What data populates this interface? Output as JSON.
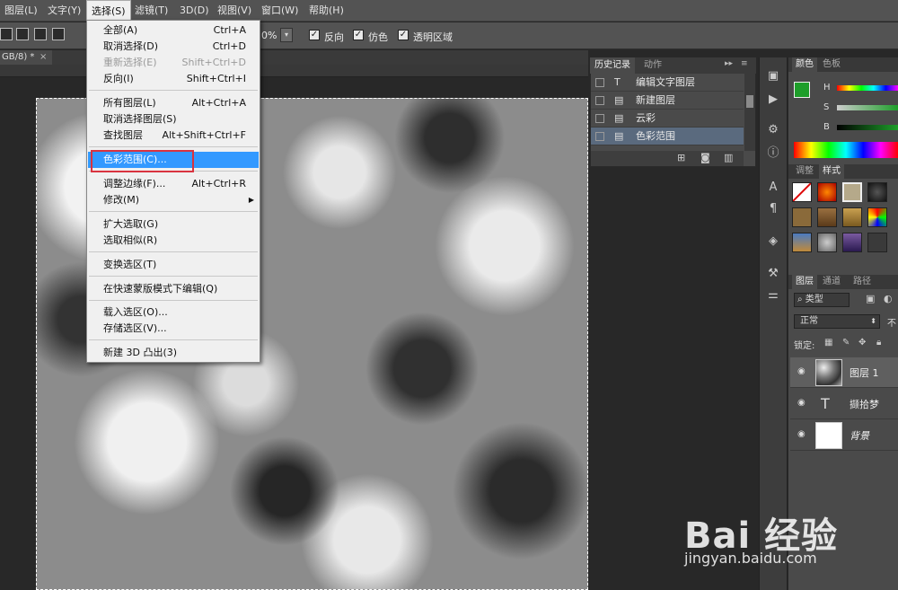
{
  "menubar": {
    "items": [
      "图层(L)",
      "文字(Y)",
      "选择(S)",
      "滤镜(T)",
      "3D(D)",
      "视图(V)",
      "窗口(W)",
      "帮助(H)"
    ]
  },
  "options": {
    "zoom": "0%",
    "invert_label": "反向",
    "dither_label": "仿色",
    "transparency_label": "透明区域"
  },
  "document": {
    "tab_title": "GB/8) *"
  },
  "select_menu": {
    "items": [
      {
        "label": "全部(A)",
        "shortcut": "Ctrl+A"
      },
      {
        "label": "取消选择(D)",
        "shortcut": "Ctrl+D"
      },
      {
        "label": "重新选择(E)",
        "shortcut": "Shift+Ctrl+D"
      },
      {
        "label": "反向(I)",
        "shortcut": "Shift+Ctrl+I"
      },
      {
        "label": "所有图层(L)",
        "shortcut": "Alt+Ctrl+A"
      },
      {
        "label": "取消选择图层(S)",
        "shortcut": ""
      },
      {
        "label": "查找图层",
        "shortcut": "Alt+Shift+Ctrl+F"
      },
      {
        "label": "色彩范围(C)...",
        "shortcut": ""
      },
      {
        "label": "调整边缘(F)...",
        "shortcut": "Alt+Ctrl+R"
      },
      {
        "label": "修改(M)",
        "shortcut": ""
      },
      {
        "label": "扩大选取(G)",
        "shortcut": ""
      },
      {
        "label": "选取相似(R)",
        "shortcut": ""
      },
      {
        "label": "变换选区(T)",
        "shortcut": ""
      },
      {
        "label": "在快速蒙版模式下编辑(Q)",
        "shortcut": ""
      },
      {
        "label": "载入选区(O)...",
        "shortcut": ""
      },
      {
        "label": "存储选区(V)...",
        "shortcut": ""
      },
      {
        "label": "新建 3D 凸出(3)",
        "shortcut": ""
      }
    ]
  },
  "history": {
    "tabs": [
      "历史记录",
      "动作"
    ],
    "items": [
      "编辑文字图层",
      "新建图层",
      "云彩",
      "色彩范围"
    ]
  },
  "color_panel": {
    "tabs": [
      "颜色",
      "色板"
    ],
    "labels": [
      "H",
      "S",
      "B"
    ]
  },
  "styles_panel": {
    "tabs": [
      "调整",
      "样式"
    ]
  },
  "layers_panel": {
    "tabs": [
      "图层",
      "通道",
      "路径"
    ],
    "filter": "类型",
    "blend_mode": "正常",
    "opacity_prefix": "不",
    "lock_label": "锁定:",
    "layers": [
      {
        "name": "图层 1"
      },
      {
        "name": "撷拾梦"
      },
      {
        "name": "背景"
      }
    ]
  },
  "watermark": {
    "brand": "Bai 经验",
    "url": "jingyan.baidu.com"
  },
  "colors": {
    "highlight": "#3399ff",
    "callout": "#d9333f",
    "foreground": "#1e9e2a",
    "background": "#ffffff"
  }
}
